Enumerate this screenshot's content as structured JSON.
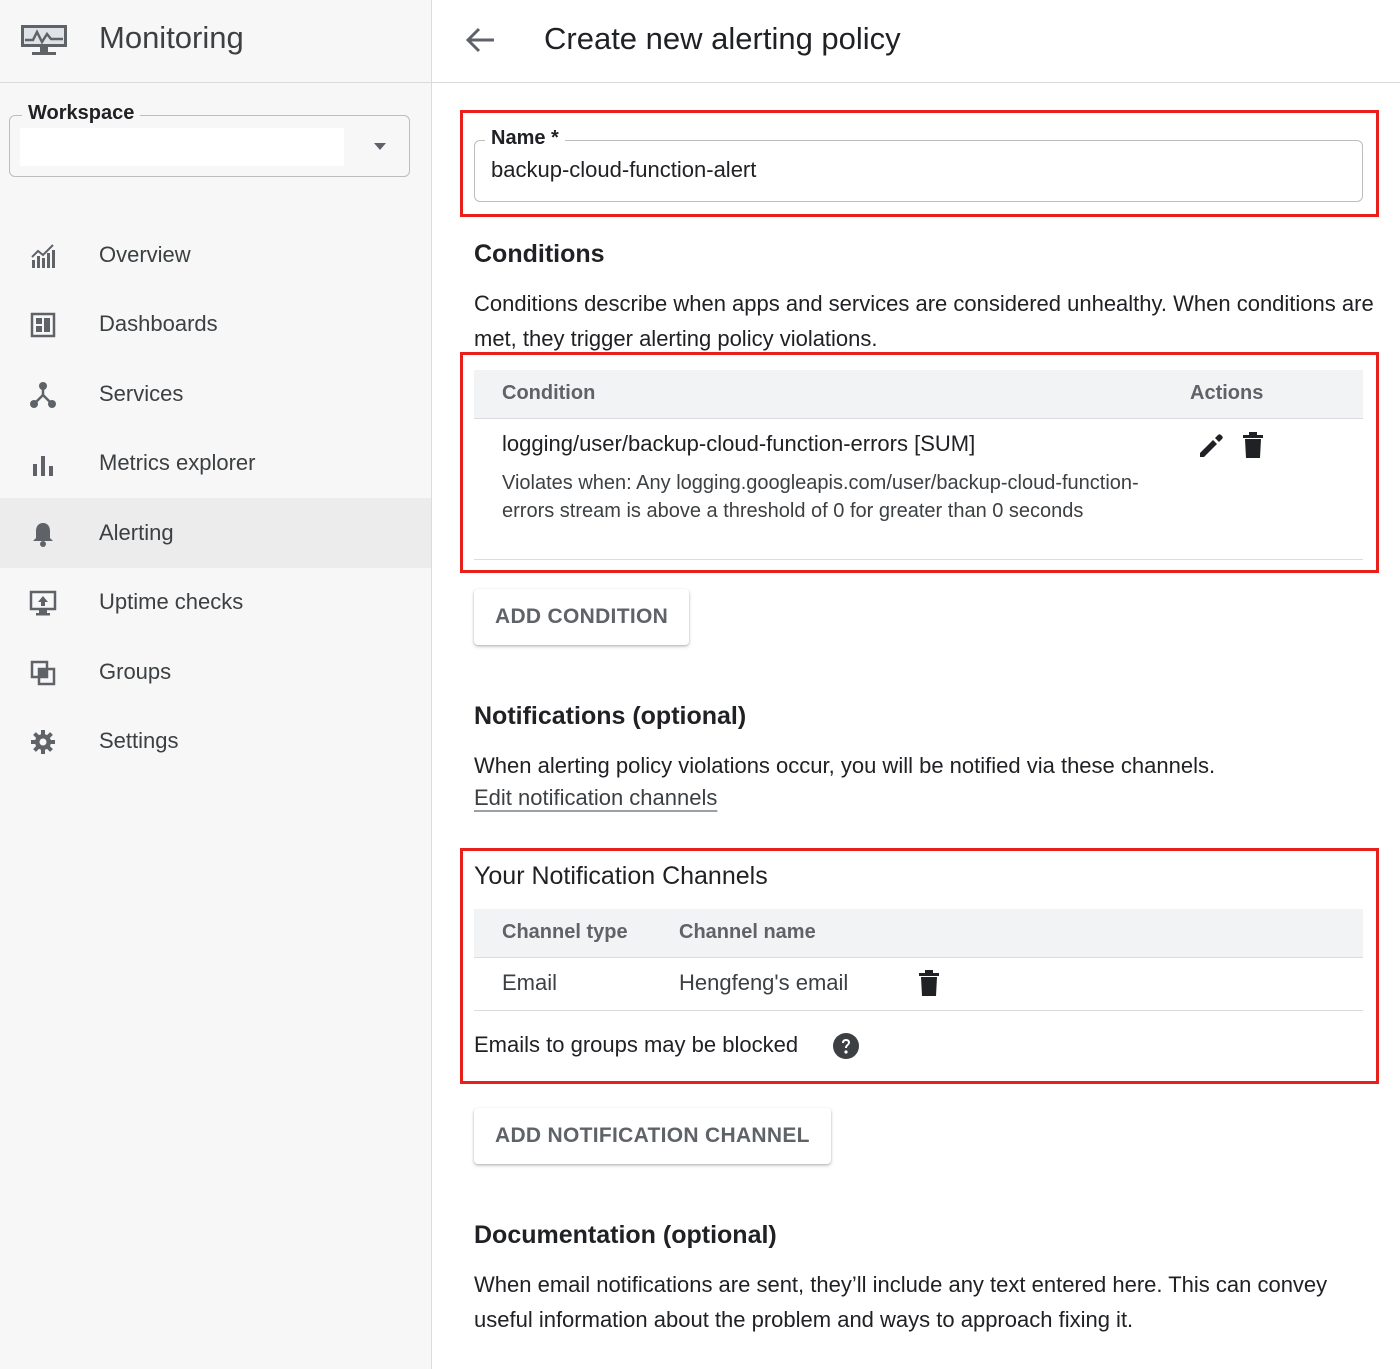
{
  "app": {
    "title": "Monitoring",
    "brand_icon": "monitoring-logo-icon"
  },
  "workspace": {
    "label": "Workspace",
    "value": ""
  },
  "nav": {
    "items": [
      {
        "label": "Overview",
        "icon": "overview-icon",
        "active": false
      },
      {
        "label": "Dashboards",
        "icon": "dashboards-icon",
        "active": false
      },
      {
        "label": "Services",
        "icon": "services-icon",
        "active": false
      },
      {
        "label": "Metrics explorer",
        "icon": "metrics-explorer-icon",
        "active": false
      },
      {
        "label": "Alerting",
        "icon": "bell-icon",
        "active": true
      },
      {
        "label": "Uptime checks",
        "icon": "uptime-checks-icon",
        "active": false
      },
      {
        "label": "Groups",
        "icon": "groups-icon",
        "active": false
      },
      {
        "label": "Settings",
        "icon": "gear-icon",
        "active": false
      }
    ]
  },
  "header": {
    "title": "Create new alerting policy",
    "back_icon": "arrow-back-icon"
  },
  "name_field": {
    "label": "Name *",
    "value": "backup-cloud-function-alert"
  },
  "conditions": {
    "title": "Conditions",
    "description": "Conditions describe when apps and services are considered unhealthy. When conditions are met, they trigger alerting policy violations.",
    "table": {
      "col_condition": "Condition",
      "col_actions": "Actions",
      "rows": [
        {
          "name": "logging/user/backup-cloud-function-errors [SUM]",
          "description": "Violates when: Any logging.googleapis.com/user/backup-cloud-function-errors stream is above a threshold of 0 for greater than 0 seconds"
        }
      ]
    },
    "add_button": "ADD CONDITION"
  },
  "notifications": {
    "title": "Notifications (optional)",
    "description": "When alerting policy violations occur, you will be notified via these channels.",
    "edit_link": "Edit notification channels",
    "channels_title": "Your Notification Channels",
    "table": {
      "col_type": "Channel type",
      "col_name": "Channel name",
      "rows": [
        {
          "type": "Email",
          "name": "Hengfeng's email"
        }
      ]
    },
    "blocked_note": "Emails to groups may be blocked",
    "add_button": "ADD NOTIFICATION CHANNEL"
  },
  "documentation": {
    "title": "Documentation (optional)",
    "description": "When email notifications are sent, they’ll include any text entered here. This can convey useful information about the problem and ways to approach fixing it."
  },
  "colors": {
    "highlight": "#e8201c",
    "sidebar_bg": "#f7f7f7",
    "active_nav_bg": "#ececec",
    "table_header_bg": "#f1f3f4"
  }
}
